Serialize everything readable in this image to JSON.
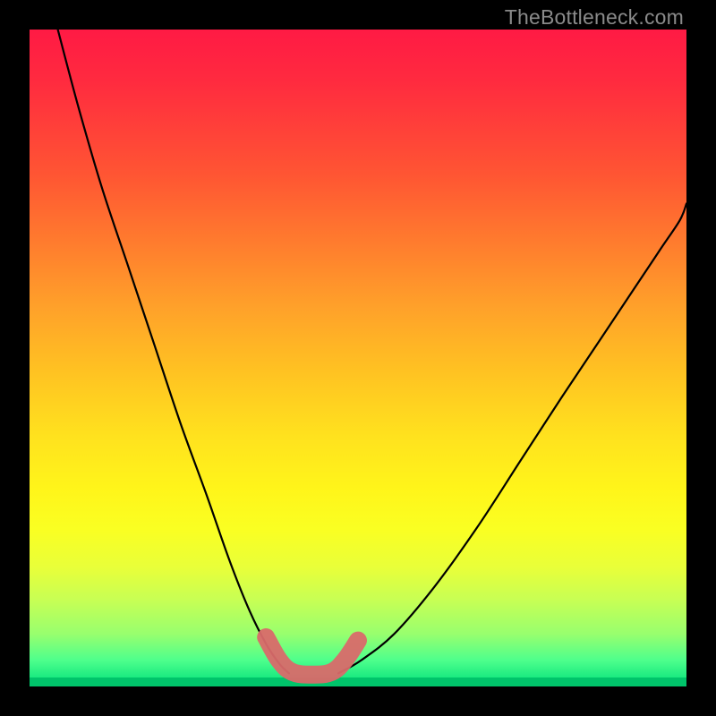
{
  "watermark": {
    "text": "TheBottleneck.com"
  },
  "chart_data": {
    "type": "line",
    "title": "",
    "xlabel": "",
    "ylabel": "",
    "xlim": [
      0,
      1
    ],
    "ylim": [
      0,
      1
    ],
    "grid": false,
    "legend": false,
    "background": "rainbow-vertical",
    "note": "Axes are normalized 0-1; values estimated from pixel positions. y=1 is top (red), y=0 is bottom (green).",
    "series": [
      {
        "name": "black-curve-left",
        "stroke": "#000000",
        "stroke_width": 2.2,
        "x": [
          0.043,
          0.075,
          0.11,
          0.15,
          0.19,
          0.23,
          0.27,
          0.305,
          0.335,
          0.36,
          0.38,
          0.395
        ],
        "y": [
          1.0,
          0.88,
          0.76,
          0.64,
          0.52,
          0.4,
          0.29,
          0.19,
          0.115,
          0.065,
          0.035,
          0.02
        ]
      },
      {
        "name": "black-curve-right",
        "stroke": "#000000",
        "stroke_width": 2.2,
        "x": [
          0.47,
          0.505,
          0.555,
          0.615,
          0.68,
          0.745,
          0.81,
          0.87,
          0.92,
          0.96,
          0.99,
          1.0
        ],
        "y": [
          0.02,
          0.04,
          0.08,
          0.15,
          0.24,
          0.34,
          0.44,
          0.53,
          0.605,
          0.665,
          0.71,
          0.735
        ]
      },
      {
        "name": "pink-flat-zone",
        "stroke": "#d96a6a",
        "stroke_width": 20,
        "x": [
          0.36,
          0.38,
          0.4,
          0.43,
          0.46,
          0.48,
          0.5
        ],
        "y": [
          0.075,
          0.04,
          0.022,
          0.018,
          0.022,
          0.04,
          0.07
        ]
      }
    ]
  }
}
